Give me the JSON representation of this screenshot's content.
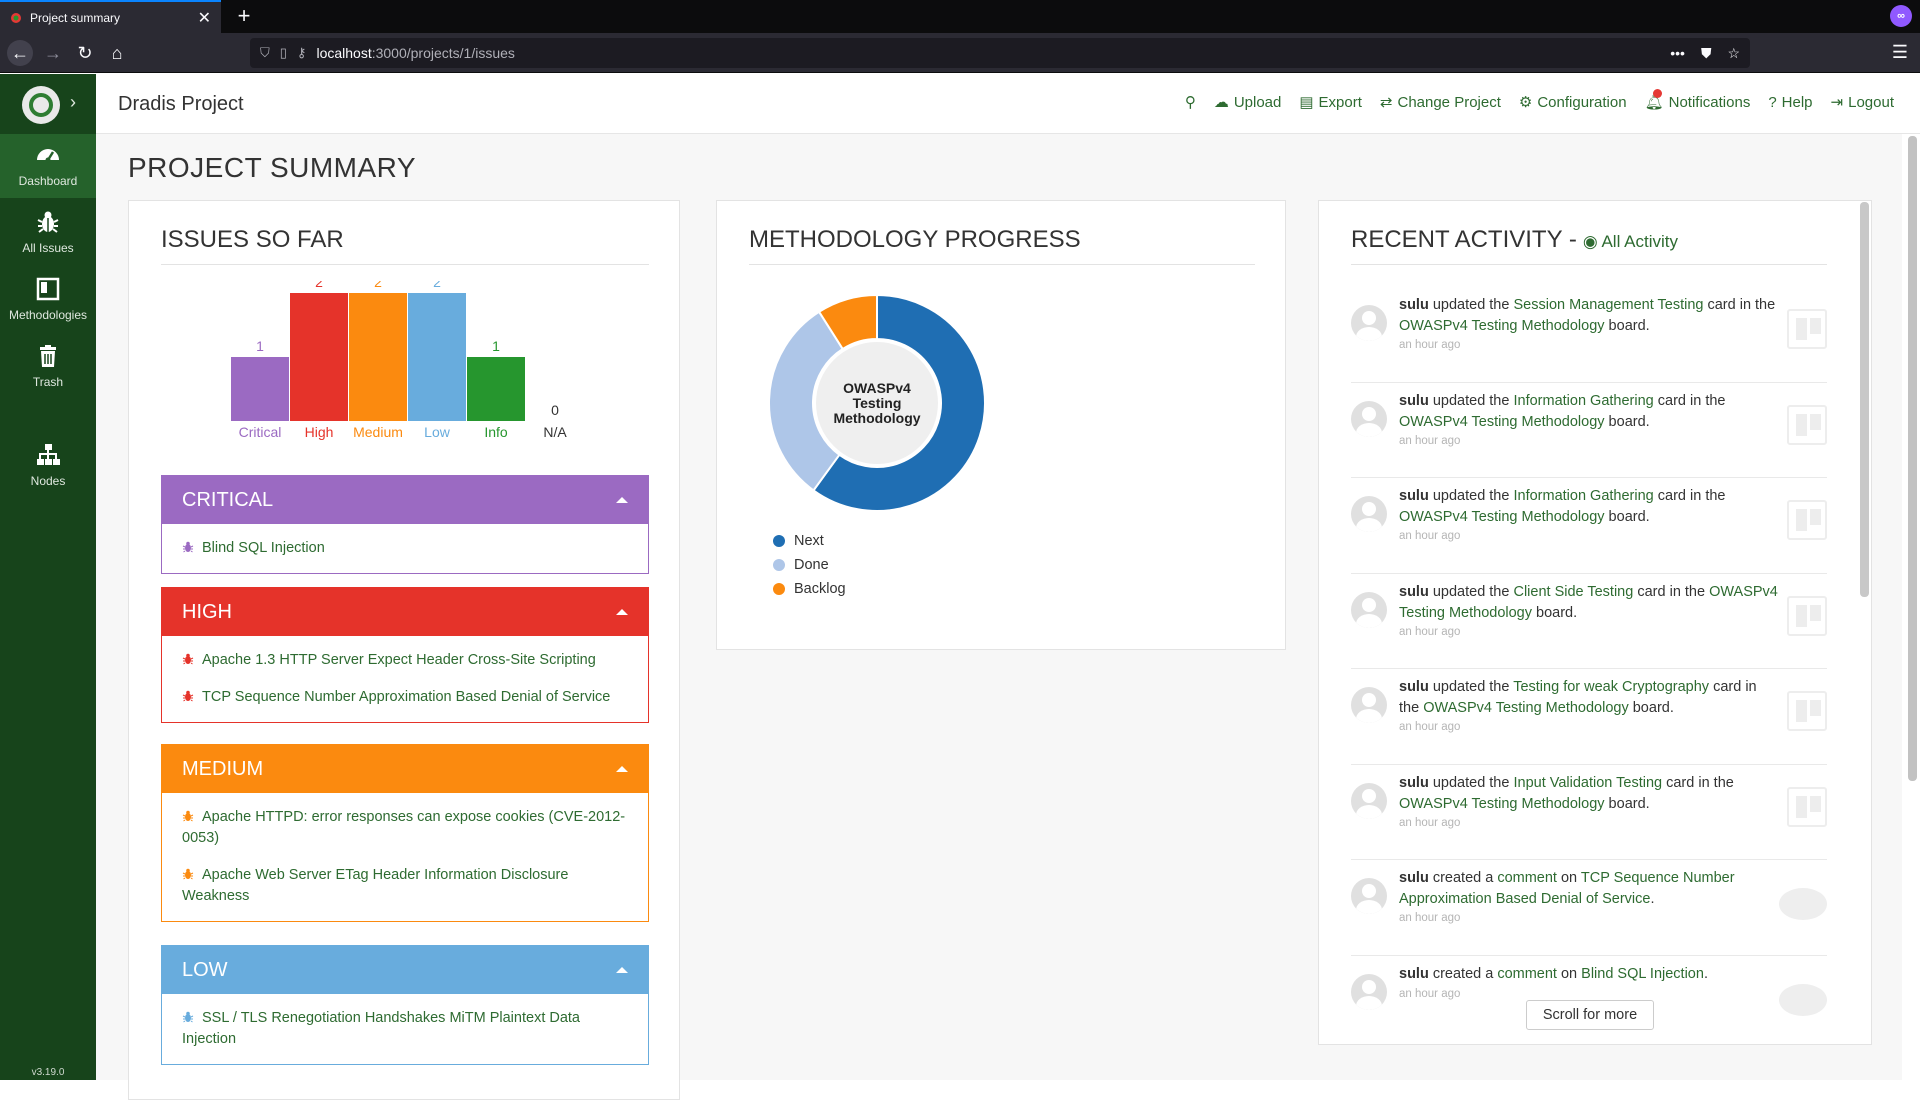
{
  "browser": {
    "tab_title": "Project summary",
    "url_host": "localhost",
    "url_path": ":3000/projects/1/issues"
  },
  "sidebar": {
    "items": [
      {
        "label": "Dashboard",
        "icon": "dashboard-icon"
      },
      {
        "label": "All Issues",
        "icon": "bug-icon"
      },
      {
        "label": "Methodologies",
        "icon": "board-icon"
      },
      {
        "label": "Trash",
        "icon": "trash-icon"
      },
      {
        "label": "Nodes",
        "icon": "nodes-icon"
      }
    ],
    "version": "v3.19.0"
  },
  "header": {
    "title": "Dradis Project",
    "nav": {
      "upload": "Upload",
      "export": "Export",
      "change_project": "Change Project",
      "configuration": "Configuration",
      "notifications": "Notifications",
      "help": "Help",
      "logout": "Logout"
    }
  },
  "page_title": "PROJECT SUMMARY",
  "issues": {
    "title": "ISSUES SO FAR",
    "colors": {
      "critical": "#9b6ac2",
      "high": "#e5332a",
      "medium": "#fb8a0f",
      "low": "#68acdd",
      "info": "#26962e"
    },
    "sections": [
      {
        "label": "CRITICAL",
        "items": [
          "Blind SQL Injection"
        ]
      },
      {
        "label": "HIGH",
        "items": [
          "Apache 1.3 HTTP Server Expect Header Cross-Site Scripting",
          "TCP Sequence Number Approximation Based Denial of Service"
        ]
      },
      {
        "label": "MEDIUM",
        "items": [
          "Apache HTTPD: error responses can expose cookies (CVE-2012-0053)",
          "Apache Web Server ETag Header Information Disclosure Weakness"
        ]
      },
      {
        "label": "LOW",
        "items": [
          "SSL / TLS Renegotiation Handshakes MiTM Plaintext Data Injection"
        ]
      }
    ]
  },
  "chart_data": [
    {
      "type": "bar",
      "categories": [
        "Critical",
        "High",
        "Medium",
        "Low",
        "Info",
        "N/A"
      ],
      "values": [
        1,
        2,
        2,
        2,
        1,
        0
      ],
      "colors": [
        "#9b6ac2",
        "#e5332a",
        "#fb8a0f",
        "#68acdd",
        "#26962e",
        "#333333"
      ]
    },
    {
      "type": "pie",
      "title": "OWASPv4 Testing Methodology",
      "categories": [
        "Next",
        "Done",
        "Backlog"
      ],
      "values": [
        60,
        31,
        9
      ],
      "colors": [
        "#1f6eb3",
        "#aec6e8",
        "#fb8a0f"
      ]
    }
  ],
  "methodology": {
    "title": "METHODOLOGY PROGRESS",
    "center_label_lines": [
      "OWASPv4",
      "Testing",
      "Methodology"
    ],
    "legend": [
      "Next",
      "Done",
      "Backlog"
    ]
  },
  "activity": {
    "title": "RECENT ACTIVITY - ",
    "all_link": "All Activity",
    "items": [
      {
        "user": "sulu",
        "pre": " updated the ",
        "link1": "Session Management Testing",
        "mid": " card in the ",
        "link2": "OWASPv4 Testing Methodology",
        "post": " board.",
        "time": "an hour ago"
      },
      {
        "user": "sulu",
        "pre": " updated the ",
        "link1": "Information Gathering",
        "mid": " card in the ",
        "link2": "OWASPv4 Testing Methodology",
        "post": " board.",
        "time": "an hour ago"
      },
      {
        "user": "sulu",
        "pre": " updated the ",
        "link1": "Information Gathering",
        "mid": " card in the ",
        "link2": "OWASPv4 Testing Methodology",
        "post": " board.",
        "time": "an hour ago"
      },
      {
        "user": "sulu",
        "pre": " updated the ",
        "link1": "Client Side Testing",
        "mid": " card in the ",
        "link2": "OWASPv4 Testing Methodology",
        "post": " board.",
        "time": "an hour ago"
      },
      {
        "user": "sulu",
        "pre": " updated the ",
        "link1": "Testing for weak Cryptography",
        "mid": " card in the ",
        "link2": "OWASPv4 Testing Methodology",
        "post": " board.",
        "time": "an hour ago"
      },
      {
        "user": "sulu",
        "pre": " updated the ",
        "link1": "Input Validation Testing",
        "mid": " card in the ",
        "link2": "OWASPv4 Testing Methodology",
        "post": " board.",
        "time": "an hour ago"
      },
      {
        "user": "sulu",
        "pre": " created a ",
        "link1": "comment",
        "mid": " on ",
        "link2": "TCP Sequence Number Approximation Based Denial of Service",
        "post": ".",
        "time": "an hour ago"
      },
      {
        "user": "sulu",
        "pre": " created a ",
        "link1": "comment",
        "mid": " on ",
        "link2": "Blind SQL Injection",
        "post": ".",
        "time": "an hour ago"
      }
    ],
    "scroll_more": "Scroll for more"
  }
}
